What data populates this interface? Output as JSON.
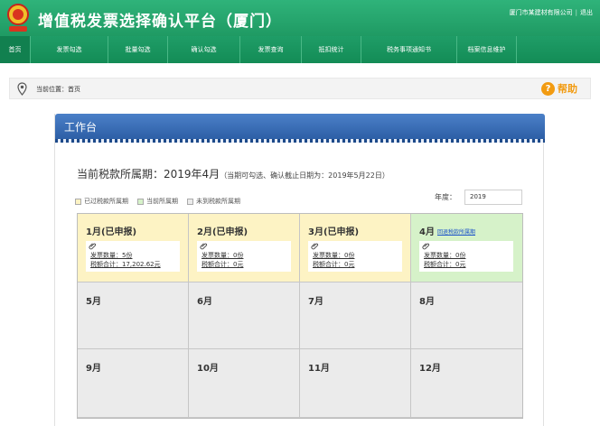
{
  "app": {
    "title": "增值税发票选择确认平台（厦门）"
  },
  "header": {
    "company": "厦门市某建材有限公司",
    "logout": "退出",
    "separator": "|"
  },
  "nav": {
    "items": [
      {
        "label": "首页"
      },
      {
        "label": "发票勾选"
      },
      {
        "label": "批量勾选"
      },
      {
        "label": "确认勾选"
      },
      {
        "label": "发票查询"
      },
      {
        "label": "抵扣统计"
      },
      {
        "label": "税务事项通知书"
      },
      {
        "label": "档案信息维护"
      }
    ],
    "active_index": 0
  },
  "breadcrumb": {
    "text": "当前位置：首页"
  },
  "help": {
    "icon": "help-icon",
    "label": "帮助"
  },
  "panel": {
    "title": "工作台",
    "period_main": "当前税款所属期：2019年4月",
    "period_note": "（当期可勾选、确认截止日期为：2019年5月22日）"
  },
  "legend": [
    {
      "label": "已过税款所属期",
      "color": "#fdf3c4"
    },
    {
      "label": "当前所属期",
      "color": "#d6f2c9"
    },
    {
      "label": "未到税款所属期",
      "color": "#ebebeb"
    }
  ],
  "year": {
    "label": "年度：",
    "value": "2019"
  },
  "months": [
    {
      "label": "1月(已申报)",
      "state": "past",
      "count": "发票数量：5份",
      "tax": "税额合计：17,202.62元"
    },
    {
      "label": "2月(已申报)",
      "state": "past",
      "count": "发票数量：0份",
      "tax": "税额合计：0元"
    },
    {
      "label": "3月(已申报)",
      "state": "past",
      "count": "发票数量：0份",
      "tax": "税额合计：0元"
    },
    {
      "label": "4月",
      "state": "current",
      "link": "回退税款所属期",
      "count": "发票数量：0份",
      "tax": "税额合计：0元"
    },
    {
      "label": "5月",
      "state": "future"
    },
    {
      "label": "6月",
      "state": "future"
    },
    {
      "label": "7月",
      "state": "future"
    },
    {
      "label": "8月",
      "state": "future"
    },
    {
      "label": "9月",
      "state": "future"
    },
    {
      "label": "10月",
      "state": "future"
    },
    {
      "label": "11月",
      "state": "future"
    },
    {
      "label": "12月",
      "state": "future"
    }
  ]
}
